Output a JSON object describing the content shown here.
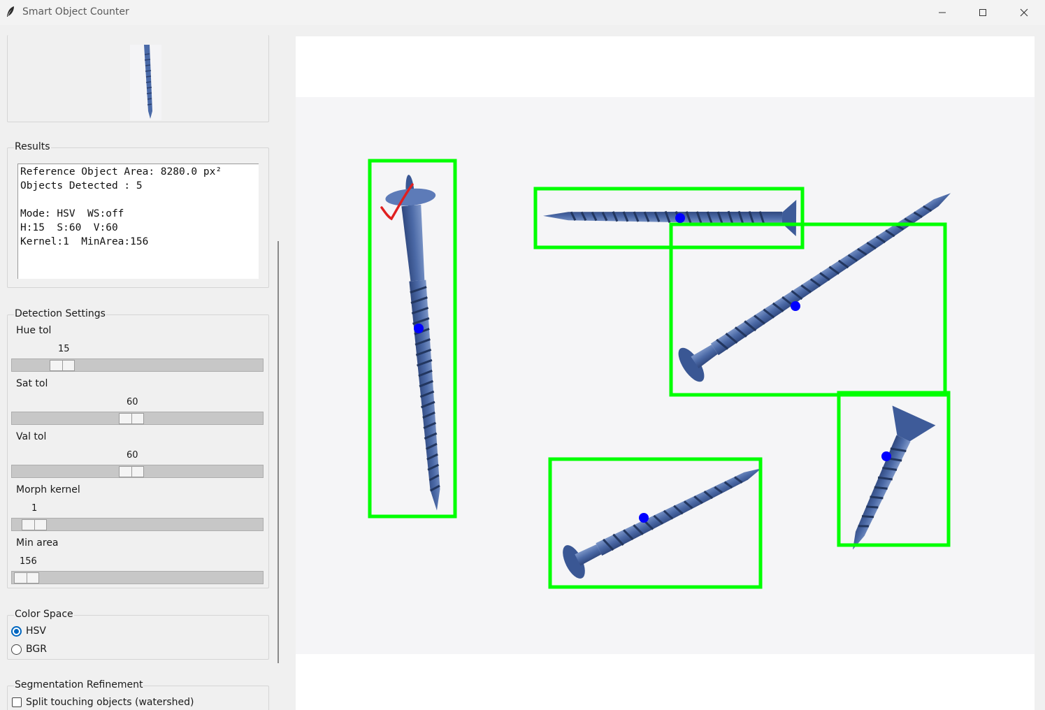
{
  "window": {
    "title": "Smart Object Counter"
  },
  "results": {
    "label": "Results",
    "lines": [
      "Reference Object Area: 8280.0 px²",
      "Objects Detected : 5",
      "",
      "Mode: HSV  WS:off",
      "H:15  S:60  V:60",
      "Kernel:1  MinArea:156"
    ]
  },
  "detection": {
    "label": "Detection Settings",
    "sliders": [
      {
        "label": "Hue tol",
        "value": "15",
        "level": 0.2
      },
      {
        "label": "Sat tol",
        "value": "60",
        "level": 0.47
      },
      {
        "label": "Val tol",
        "value": "60",
        "level": 0.47
      },
      {
        "label": "Morph kernel",
        "value": "1",
        "level": 0.0
      },
      {
        "label": "Min area",
        "value": "156",
        "level": 0.01
      }
    ]
  },
  "color_space": {
    "label": "Color Space",
    "options": [
      "HSV",
      "BGR"
    ],
    "selected": "HSV"
  },
  "segmentation": {
    "label": "Segmentation Refinement",
    "watershed_label": "Split touching objects (watershed)",
    "watershed_checked": false
  },
  "image_view": {
    "detected_count": 5,
    "box_color": "#00ff00",
    "centroid_color": "#0000ff",
    "reference_mark_color": "#e02020"
  },
  "colors": {
    "accent": "#0067c0",
    "screw": "#4a6aa8"
  }
}
